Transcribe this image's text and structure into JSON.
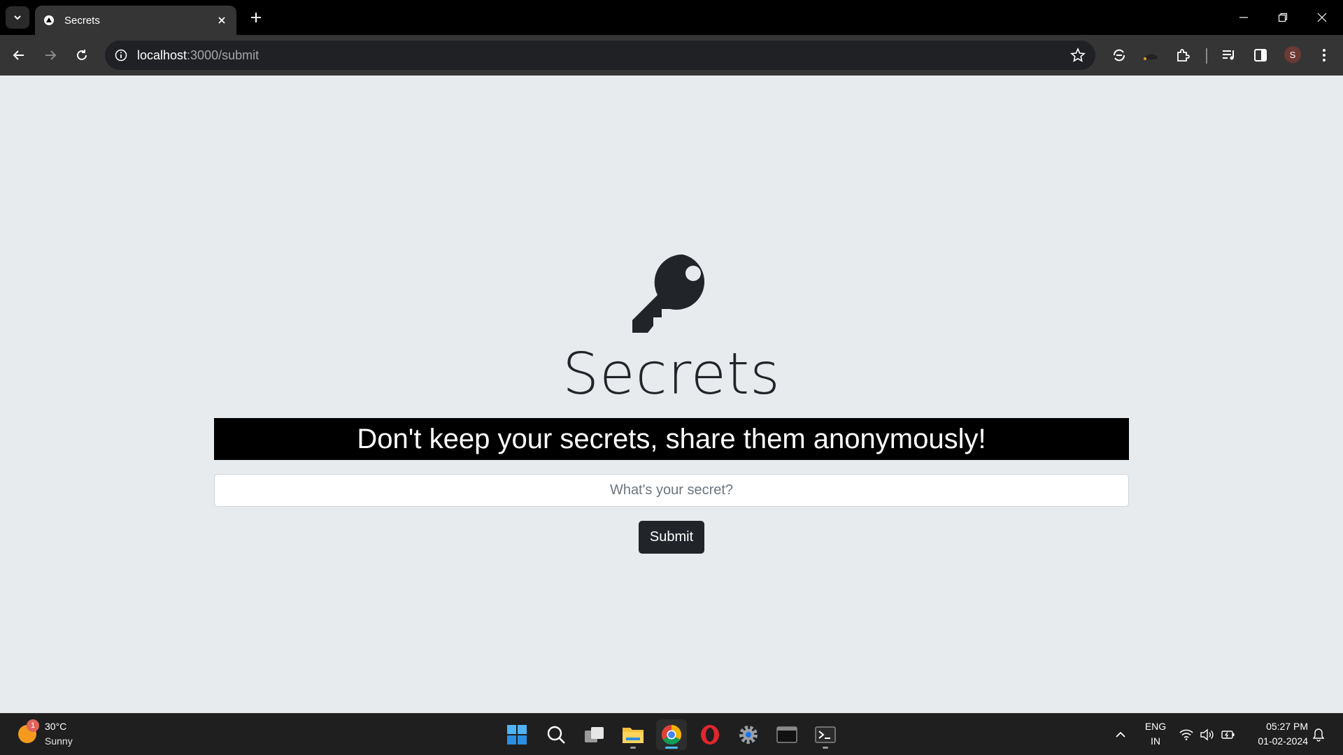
{
  "browser": {
    "tab": {
      "title": "Secrets"
    },
    "url": {
      "host": "localhost",
      "path": ":3000/submit"
    },
    "profile_initial": "S"
  },
  "page": {
    "title": "Secrets",
    "banner": "Don't keep your secrets, share them anonymously!",
    "secret_input": {
      "value": "",
      "placeholder": "What's your secret?"
    },
    "submit_label": "Submit"
  },
  "taskbar": {
    "weather": {
      "temp": "30°C",
      "desc": "Sunny",
      "badge": "1"
    },
    "language": {
      "line1": "ENG",
      "line2": "IN"
    },
    "clock": {
      "time": "05:27 PM",
      "date": "01-02-2024"
    },
    "apps": [
      "start-icon",
      "search-icon",
      "task-view-icon",
      "file-explorer-icon",
      "chrome-icon",
      "opera-icon",
      "settings-icon",
      "terminal-icon",
      "powershell-icon"
    ]
  },
  "colors": {
    "page_bg": "#e8ebee",
    "banner_bg": "#000000",
    "button_bg": "#212529",
    "title": "#212529"
  }
}
